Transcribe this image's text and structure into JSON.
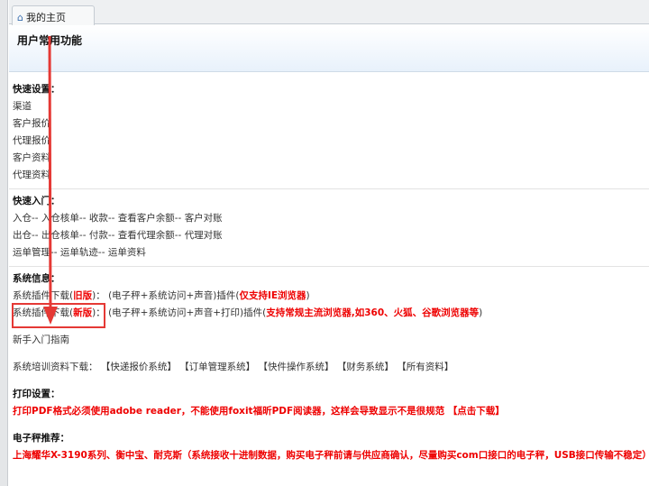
{
  "tab": {
    "label": "我的主页",
    "icon": "home-icon"
  },
  "header": {
    "title": "用户常用功能"
  },
  "quick_settings": {
    "title": "快速设置：",
    "items": [
      "渠道",
      "客户报价",
      "代理报价",
      "客户资料",
      "代理资料"
    ]
  },
  "quick_entry": {
    "title": "快速入门：",
    "rows": [
      [
        "入仓",
        "入仓核单",
        "收款",
        "查看客户余额",
        "客户对账"
      ],
      [
        "出仓",
        "出仓核单",
        "付款",
        "查看代理余额",
        "代理对账"
      ],
      [
        "运单管理",
        "运单轨迹",
        "运单资料"
      ]
    ],
    "sep": "-- "
  },
  "system_info": {
    "title": "系统信息：",
    "old": {
      "label": "系统插件下载(",
      "ver": "旧版",
      "label_end": ")：",
      "desc": "(电子秤+系统访问+声音)插件(",
      "note": "仅支持IE浏览器",
      "close": ")"
    },
    "new": {
      "label": "系统插件下载(",
      "ver": "新版",
      "label_end": ")：",
      "desc": "(电子秤+系统访问+声音+打印)插件(",
      "note": "支持常规主流浏览器,如360、火狐、谷歌浏览器等",
      "close": ")"
    },
    "guide": "新手入门指南",
    "training_label": "系统培训资料下载：",
    "training_links": [
      "【快递报价系统】",
      "【订单管理系统】",
      "【快件操作系统】",
      "【财务系统】",
      "【所有资料】"
    ]
  },
  "print": {
    "title": "打印设置：",
    "text": "打印PDF格式必须使用adobe reader，不能使用foxit福昕PDF阅读器，这样会导致显示不是很规范",
    "link": "【点击下载】"
  },
  "scale": {
    "title": "电子秤推荐：",
    "text": "上海耀华X-3190系列、衡中宝、耐克斯（系统接收十进制数据，购买电子秤前请与供应商确认，尽量购买com口接口的电子秤，USB接口传输不稳定）"
  }
}
